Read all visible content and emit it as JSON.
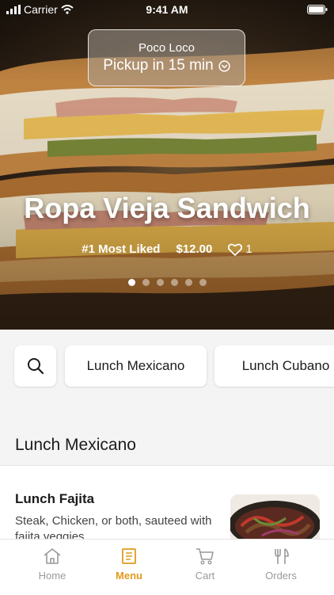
{
  "status_bar": {
    "carrier": "Carrier",
    "time": "9:41 AM",
    "icons": [
      "signal-icon",
      "wifi-icon",
      "battery-icon"
    ]
  },
  "pickup": {
    "restaurant": "Poco Loco",
    "eta": "Pickup in 15 min",
    "icon": "chevron-down-circle-icon"
  },
  "featured": {
    "title": "Ropa Vieja Sandwich",
    "rank": "#1 Most Liked",
    "price": "$12.00",
    "likes": "1",
    "carousel": {
      "count": 6,
      "active": 0
    }
  },
  "categories": {
    "search_icon": "search-icon",
    "items": [
      "Lunch Mexicano",
      "Lunch Cubano"
    ]
  },
  "menu": {
    "section_title": "Lunch Mexicano",
    "items": [
      {
        "name": "Lunch Fajita",
        "description": "Steak, Chicken, or both, sauteed with fajita veggies"
      }
    ]
  },
  "tabbar": {
    "tabs": [
      {
        "label": "Home",
        "icon": "home-icon"
      },
      {
        "label": "Menu",
        "icon": "menu-book-icon",
        "active": true
      },
      {
        "label": "Cart",
        "icon": "cart-icon"
      },
      {
        "label": "Orders",
        "icon": "fork-knife-icon"
      }
    ]
  },
  "colors": {
    "accent": "#e09a1c",
    "inactive": "#9a9a9a",
    "background": "#f4f4f4"
  }
}
